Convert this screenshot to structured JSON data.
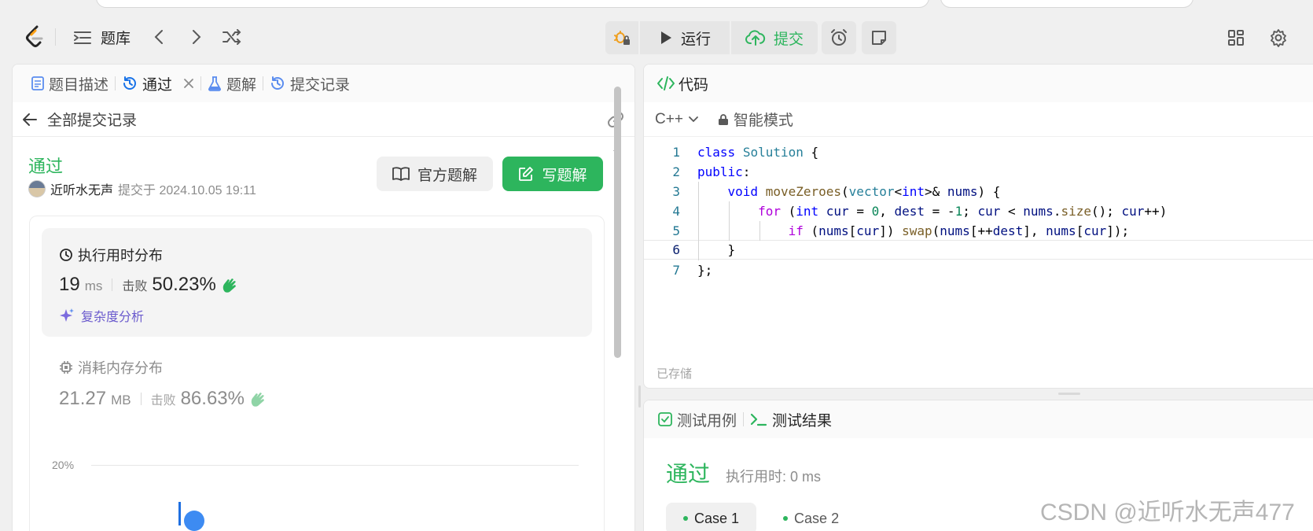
{
  "header": {
    "problem_bank_label": "题库",
    "run_label": "运行",
    "submit_label": "提交"
  },
  "left": {
    "tabs": [
      {
        "label": "题目描述"
      },
      {
        "label": "通过"
      },
      {
        "label": "题解"
      },
      {
        "label": "提交记录"
      }
    ],
    "back_label": "全部提交记录",
    "status": "通过",
    "submitter_name": "近听水无声",
    "submitted_at": "提交于 2024.10.05 19:11",
    "official_solution_label": "官方题解",
    "write_solution_label": "写题解",
    "runtime": {
      "title": "执行用时分布",
      "value": "19",
      "unit": "ms",
      "beat_label": "击败",
      "beat_pct": "50.23%",
      "complexity_label": "复杂度分析"
    },
    "memory": {
      "title": "消耗内存分布",
      "value": "21.27",
      "unit": "MB",
      "beat_label": "击败",
      "beat_pct": "86.63%"
    },
    "chart_axis_label": "20%"
  },
  "code": {
    "tab_label": "代码",
    "language": "C++",
    "mode_label": "智能模式",
    "line_numbers": [
      "1",
      "2",
      "3",
      "4",
      "5",
      "6",
      "7"
    ],
    "saved_label": "已存储"
  },
  "test": {
    "cases_tab": "测试用例",
    "result_tab": "测试结果",
    "status": "通过",
    "exec_time": "执行用时: 0 ms",
    "cases": [
      "Case 1",
      "Case 2"
    ]
  },
  "watermark": "CSDN @近听水无声477",
  "colors": {
    "accent_green": "#2db55d",
    "complexity_purple": "#6a5acd"
  }
}
